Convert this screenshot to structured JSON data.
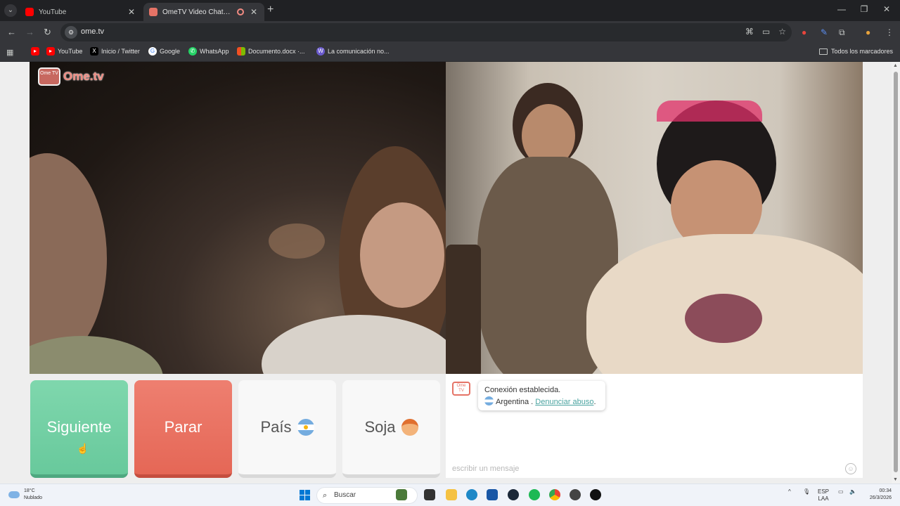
{
  "browser": {
    "tabs": [
      {
        "title": "YouTube",
        "active": false,
        "favicon_color": "#ff0000"
      },
      {
        "title": "OmeTV Video Chat — Alte",
        "active": true,
        "favicon_color": "#e57366"
      }
    ],
    "url": "ome.tv",
    "bookmarks": [
      {
        "label": "",
        "icon": "youtube-icon",
        "color": "#ff0000"
      },
      {
        "label": "YouTube",
        "icon": "youtube-icon",
        "color": "#ff0000"
      },
      {
        "label": "Inicio / Twitter",
        "icon": "x-icon",
        "color": "#000000"
      },
      {
        "label": "Google",
        "icon": "google-icon",
        "color": "#4285f4"
      },
      {
        "label": "WhatsApp",
        "icon": "whatsapp-icon",
        "color": "#25d366"
      },
      {
        "label": "Documento.docx ·...",
        "icon": "microsoft-icon",
        "color": "#f25022"
      },
      {
        "label": "La comunicación no...",
        "icon": "wordpress-icon",
        "color": "#6a5acd"
      }
    ],
    "all_bookmarks_label": "Todos los marcadores"
  },
  "page": {
    "logo_text": "Ome.tv",
    "logo_badge": "Ome TV",
    "buttons": {
      "next_label": "Siguiente",
      "stop_label": "Parar",
      "country_label": "País",
      "gender_label": "Soja"
    },
    "chat": {
      "status": "Conexión establecida.",
      "country": "Argentina .",
      "report_link": "Denunciar abuso",
      "report_suffix": ".",
      "input_placeholder": "escribir un mensaje"
    }
  },
  "taskbar": {
    "weather_temp": "18°C",
    "weather_desc": "Nublado",
    "search_placeholder": "Buscar",
    "lang_top": "ESP",
    "lang_bottom": "LAA",
    "time": "00:34",
    "date": "26/3/2026"
  },
  "colors": {
    "next_button": "#6fcf9f",
    "stop_button": "#e86a5b",
    "accent_link": "#4aa3a0"
  }
}
